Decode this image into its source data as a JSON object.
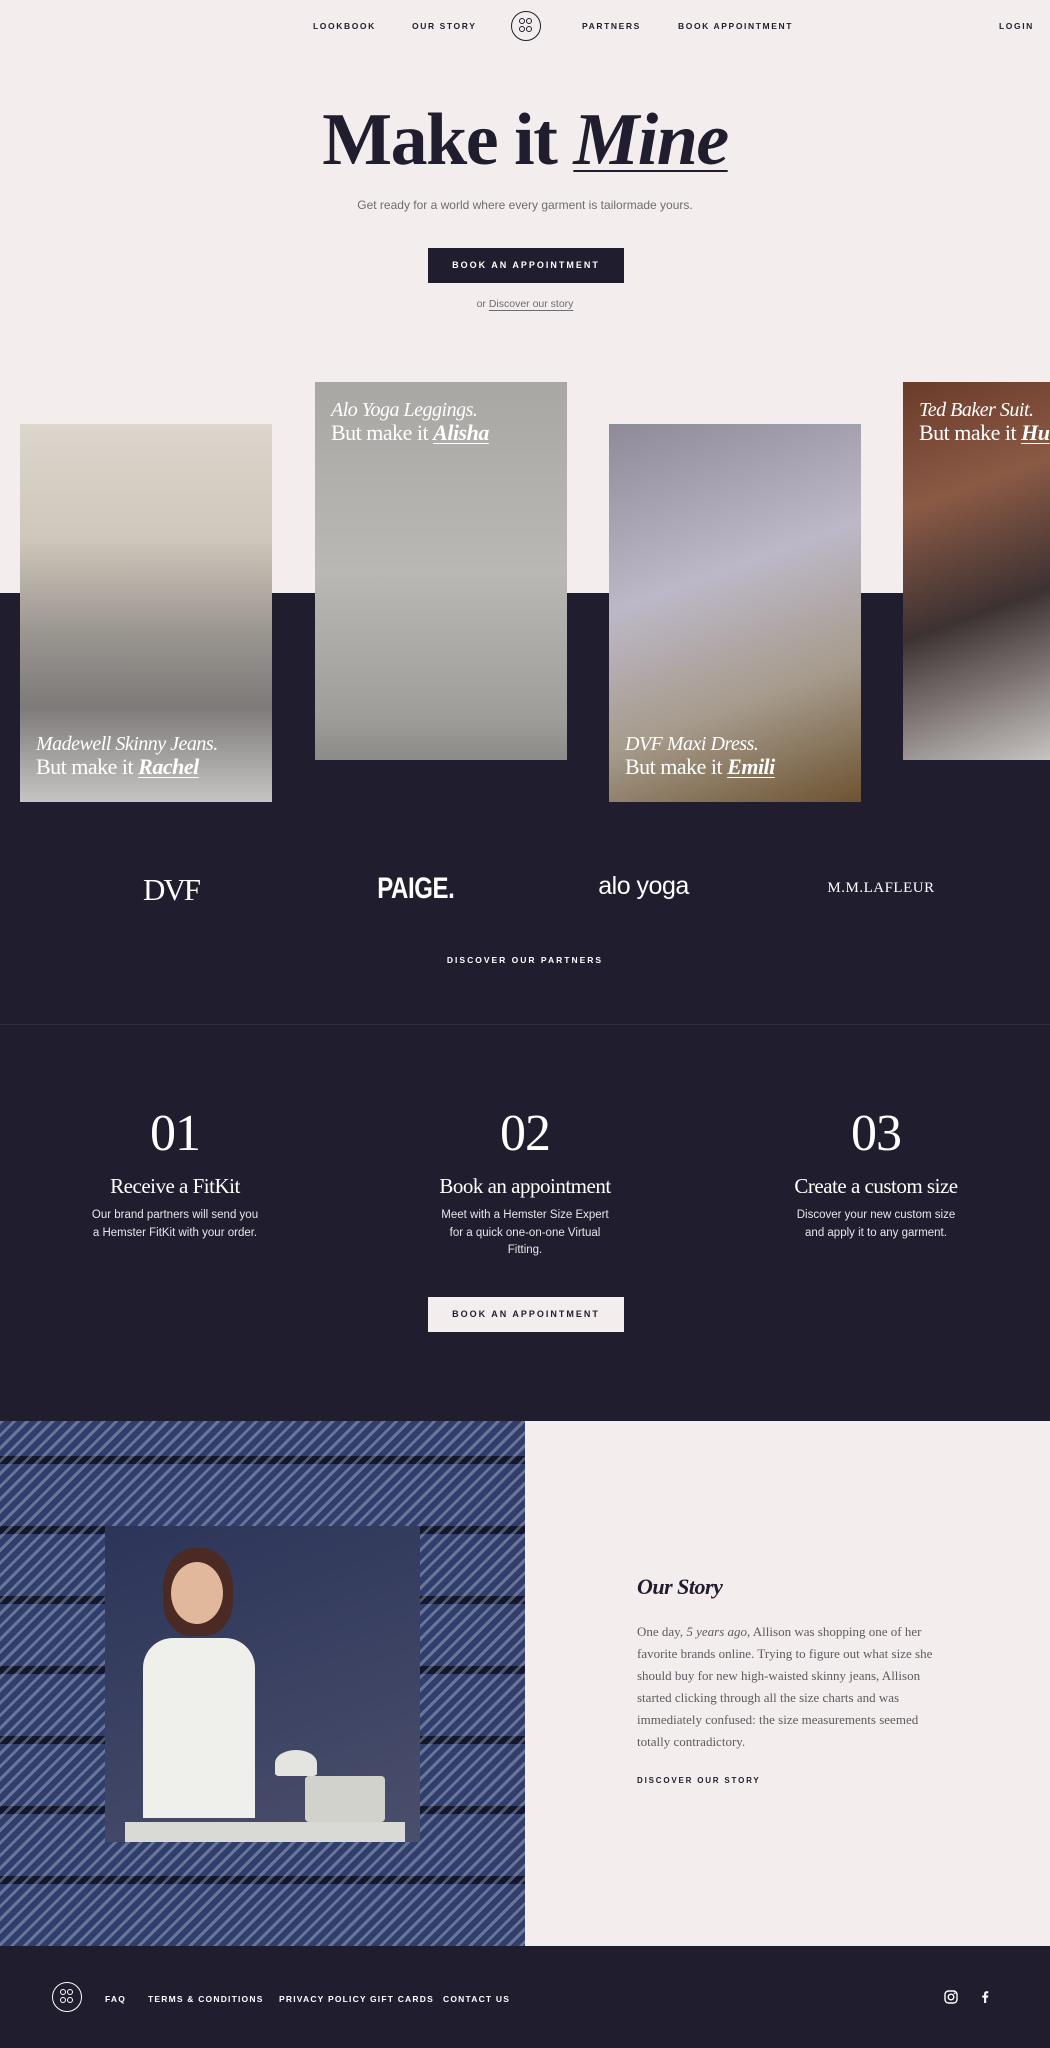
{
  "nav": {
    "lookbook": "LOOKBOOK",
    "our_story": "OUR STORY",
    "partners": "PARTNERS",
    "book_appointment": "BOOK APPOINTMENT",
    "login": "LOGIN"
  },
  "hero": {
    "title_start": "Make it",
    "title_script": "Mine",
    "subtitle": "Get ready for a world where every garment is tailormade yours.",
    "cta": "BOOK AN APPOINTMENT",
    "or_text": "or",
    "discover_link": "Discover our story"
  },
  "lookbook": [
    {
      "item": "Madewell Skinny Jeans.",
      "prefix": "But make it",
      "name": "Rachel"
    },
    {
      "item": "Alo Yoga Leggings.",
      "prefix": "But make it",
      "name": "Alisha"
    },
    {
      "item": "DVF Maxi Dress.",
      "prefix": "But make it",
      "name": "Emili"
    },
    {
      "item": "Ted Baker Suit.",
      "prefix": "But make it",
      "name": "Hu"
    }
  ],
  "partners": {
    "logos": [
      "DVF",
      "PAIGE.",
      "alo yoga",
      "M.M.LAFLEUR"
    ],
    "discover": "DISCOVER OUR PARTNERS"
  },
  "steps": [
    {
      "num": "01",
      "title": "Receive a FitKit",
      "desc": "Our brand partners will send you a Hemster FitKit with your order."
    },
    {
      "num": "02",
      "title": "Book an appointment",
      "desc": "Meet with a Hemster Size Expert for a quick one-on-one Virtual Fitting."
    },
    {
      "num": "03",
      "title": "Create a custom size",
      "desc": "Discover your new custom size and apply it to any garment."
    }
  ],
  "steps_cta": "BOOK AN APPOINTMENT",
  "story": {
    "title": "Our Story",
    "text_before": "One day,",
    "text_italic": "5 years ago",
    "text_after": ", Allison was shopping one of her favorite brands online.  Trying to figure out what size she should buy for new high-waisted skinny jeans, Allison started clicking through all the size charts and was immediately confused: the size measurements seemed totally contradictory.",
    "link": "DISCOVER OUR STORY"
  },
  "footer": {
    "faq": "FAQ",
    "terms": "TERMS & CONDITIONS",
    "privacy": "PRIVACY POLICY",
    "gift_cards": "GIFT  CARDS",
    "contact": "CONTACT US",
    "social": [
      "instagram-icon",
      "facebook-icon"
    ]
  },
  "colors": {
    "dark": "#1f1d2e",
    "light": "#f3eeed"
  }
}
